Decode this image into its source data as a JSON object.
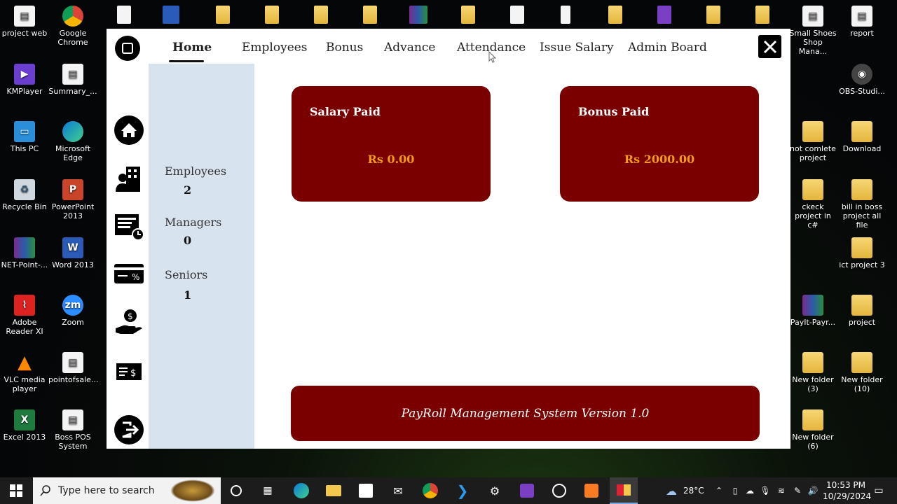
{
  "desktop": {
    "left_icons": [
      {
        "label": "project web",
        "type": "file"
      },
      {
        "label": "Google Chrome",
        "type": "chrome"
      },
      {
        "label": "KMPlayer",
        "type": "kmp"
      },
      {
        "label": "Summary_...",
        "type": "file"
      },
      {
        "label": "This PC",
        "type": "pc"
      },
      {
        "label": "Microsoft Edge",
        "type": "edge"
      },
      {
        "label": "Recycle Bin",
        "type": "recycle"
      },
      {
        "label": "PowerPoint 2013",
        "type": "ppt"
      },
      {
        "label": "NET-Point-...",
        "type": "winrar"
      },
      {
        "label": "Word 2013",
        "type": "word"
      },
      {
        "label": "Adobe Reader XI",
        "type": "pdf"
      },
      {
        "label": "Zoom",
        "type": "zoom"
      },
      {
        "label": "VLC media player",
        "type": "vlc"
      },
      {
        "label": "pointofsale...",
        "type": "file"
      },
      {
        "label": "Excel 2013",
        "type": "excel"
      },
      {
        "label": "Boss POS System",
        "type": "file"
      }
    ],
    "right_icons": [
      {
        "label": "Small Shoes Shop Mana...",
        "type": "file"
      },
      {
        "label": "report",
        "type": "file"
      },
      {
        "label": "OBS-Studi...",
        "type": "obs"
      },
      {
        "label": "not comlete project",
        "type": "folder"
      },
      {
        "label": "Download",
        "type": "folder"
      },
      {
        "label": "ckeck project in c#",
        "type": "folder"
      },
      {
        "label": "bill in boss project all file",
        "type": "folder"
      },
      {
        "label": "ict project 3",
        "type": "folder"
      },
      {
        "label": "PayIt-Payr...",
        "type": "winrar"
      },
      {
        "label": "project",
        "type": "folder"
      },
      {
        "label": "New folder (3)",
        "type": "folder"
      },
      {
        "label": "New folder (10)",
        "type": "folder"
      },
      {
        "label": "New folder (6)",
        "type": "folder"
      }
    ]
  },
  "app": {
    "menu": [
      {
        "label": "Home",
        "active": true
      },
      {
        "label": "Employees",
        "active": false
      },
      {
        "label": "Bonus",
        "active": false
      },
      {
        "label": "Advance",
        "active": false
      },
      {
        "label": "Attendance",
        "active": false
      },
      {
        "label": "Issue Salary",
        "active": false
      },
      {
        "label": "Admin Board",
        "active": false
      }
    ],
    "sidebar_icons": [
      "home-icon",
      "employees-icon",
      "attendance-sheet-icon",
      "salary-card-icon",
      "bonus-hand-icon",
      "cash-icon",
      "logout-icon"
    ],
    "stats": {
      "employees_label": "Employees",
      "employees_value": "2",
      "managers_label": "Managers",
      "managers_value": "0",
      "seniors_label": "Seniors",
      "seniors_value": "1"
    },
    "cards": {
      "salary_title": "Salary Paid",
      "salary_value": "Rs 0.00",
      "bonus_title": "Bonus Paid",
      "bonus_value": "Rs 2000.00"
    },
    "footer": "PayRoll Management System Version 1.0",
    "colors": {
      "card": "#7a0000",
      "card_value": "#f39c12",
      "panel": "#d8e3f0"
    }
  },
  "taskbar": {
    "search_placeholder": "Type here to search",
    "weather": "28°C",
    "time": "10:53 PM",
    "date": "10/29/2024"
  }
}
